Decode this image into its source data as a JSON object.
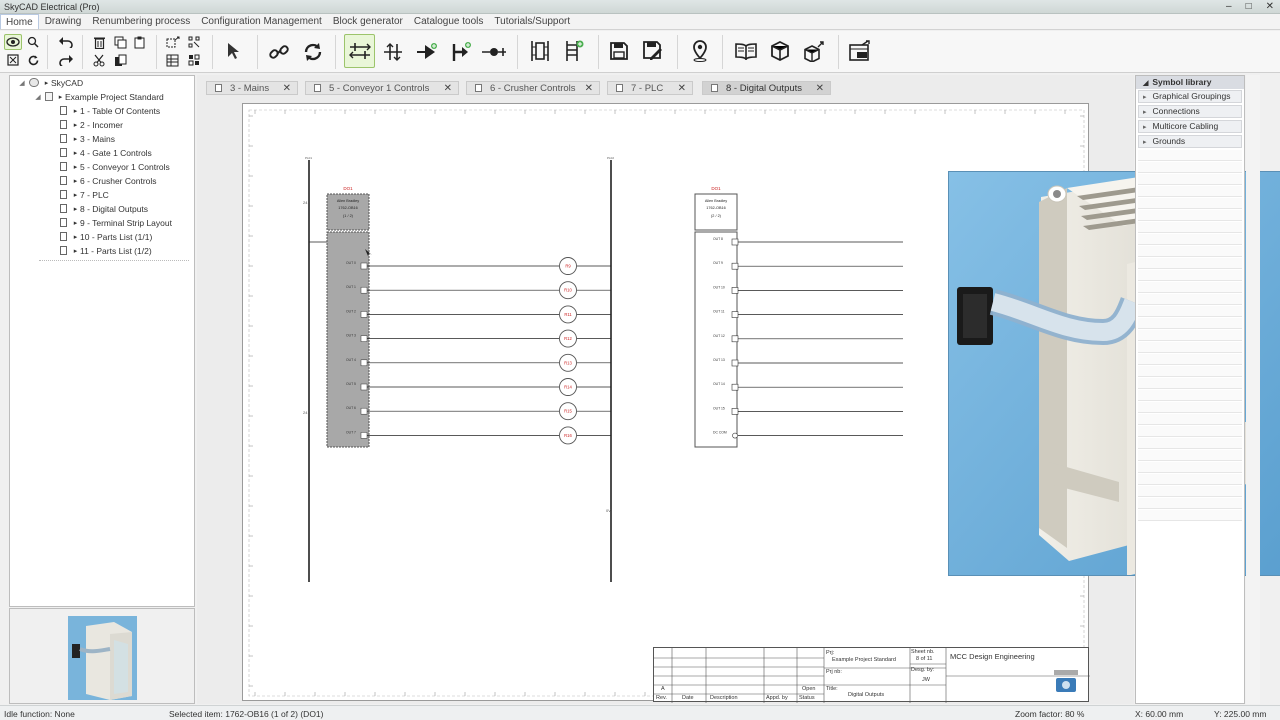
{
  "window": {
    "title": "SkyCAD Electrical (Pro)",
    "min": "–",
    "max": "□",
    "close": "✕"
  },
  "menu": [
    "Home",
    "Drawing",
    "Renumbering process",
    "Configuration Management",
    "Block generator",
    "Catalogue tools",
    "Tutorials/Support"
  ],
  "toolbar": {
    "icons": [
      "eye-icon",
      "zoom-icon",
      "undo-icon",
      "delete-icon",
      "copy-icon",
      "paste-icon",
      "group-icon",
      "ungroup-icon",
      "select-pointer-icon",
      "link-icon",
      "refresh-icon",
      "wire-mode-icon",
      "terminal-icon",
      "connector-icon",
      "junction-icon",
      "link-wire-icon",
      "symbol-insert-icon",
      "multi-symbol-icon",
      "save-icon",
      "save-as-icon",
      "location-icon",
      "book-icon",
      "3d-box-icon",
      "3d-export-icon",
      "sheet-export-icon",
      "fit-icon",
      "regen-icon",
      "redo-icon",
      "cut-icon",
      "clone-icon",
      "layer-icon",
      "properties-icon"
    ]
  },
  "tree": {
    "root": "SkyCAD",
    "project": "Example Project Standard",
    "pages": [
      "1 - Table Of Contents",
      "2 - Incomer",
      "3 - Mains",
      "4 - Gate 1 Controls",
      "5 - Conveyor 1 Controls",
      "6 - Crusher Controls",
      "7 - PLC",
      "8 - Digital Outputs",
      "9 - Terminal Strip Layout",
      "10 - Parts List (1/1)",
      "11 - Parts List (1/2)"
    ]
  },
  "tabs": [
    {
      "label": "3 - Mains",
      "close": "✕"
    },
    {
      "label": "5 - Conveyor 1 Controls",
      "close": "✕"
    },
    {
      "label": "6 - Crusher Controls",
      "close": "✕"
    },
    {
      "label": "7 - PLC",
      "close": "✕"
    },
    {
      "label": "8 - Digital Outputs",
      "close": "✕",
      "active": true
    }
  ],
  "drawing": {
    "plc1": {
      "tag": "DO1",
      "maker": "Allen Bradley",
      "part": "1762-OB16",
      "sheet": "(1 / 2)",
      "outputs": [
        "OUT 0",
        "OUT 1",
        "OUT 2",
        "OUT 3",
        "OUT 4",
        "OUT 5",
        "OUT 6",
        "OUT 7"
      ]
    },
    "plc2": {
      "tag": "DO1",
      "maker": "Allen Bradley",
      "part": "1762-OB16",
      "sheet": "(2 / 2)",
      "outputs": [
        "OUT 8",
        "OUT 9",
        "OUT 10",
        "OUT 11",
        "OUT 12",
        "OUT 13",
        "OUT 14",
        "OUT 15",
        "DC COM"
      ]
    },
    "relays": [
      "R9",
      "R10",
      "R11",
      "R12",
      "R13",
      "R14",
      "R15",
      "R16"
    ]
  },
  "titleblock": {
    "prj_label": "Prj:",
    "prj_value": "Example Project Standard",
    "prjnb_label": "Prj nb:",
    "title_label": "Title:",
    "title_value": "Digital Outputs",
    "sheet_label": "Sheet nb.",
    "sheet_value": "8  of  11",
    "desg_label": "Desg. by:",
    "desg_value": "JW",
    "company": "MCC Design Engineering",
    "rev_row": "A",
    "cols": [
      "Rev.",
      "Date",
      "Description",
      "Appd. by",
      "Status"
    ],
    "status_value": "Open"
  },
  "symbol_library": {
    "heading": "Symbol library",
    "items": [
      "Graphical Groupings",
      "Connections",
      "Multicore Cabling",
      "Grounds"
    ]
  },
  "status": {
    "function": "Idle function: None",
    "selected": "Selected item: 1762-OB16 (1 of 2) (DO1)",
    "zoom": "Zoom factor: 80 %",
    "x": "X: 60.00 mm",
    "y": "Y: 225.00 mm"
  },
  "colors": {
    "accent": "#9cc46b",
    "relay": "#cc2222",
    "plc_fill": "#a8a8a8",
    "photo_bg": "#6fb0dc"
  }
}
